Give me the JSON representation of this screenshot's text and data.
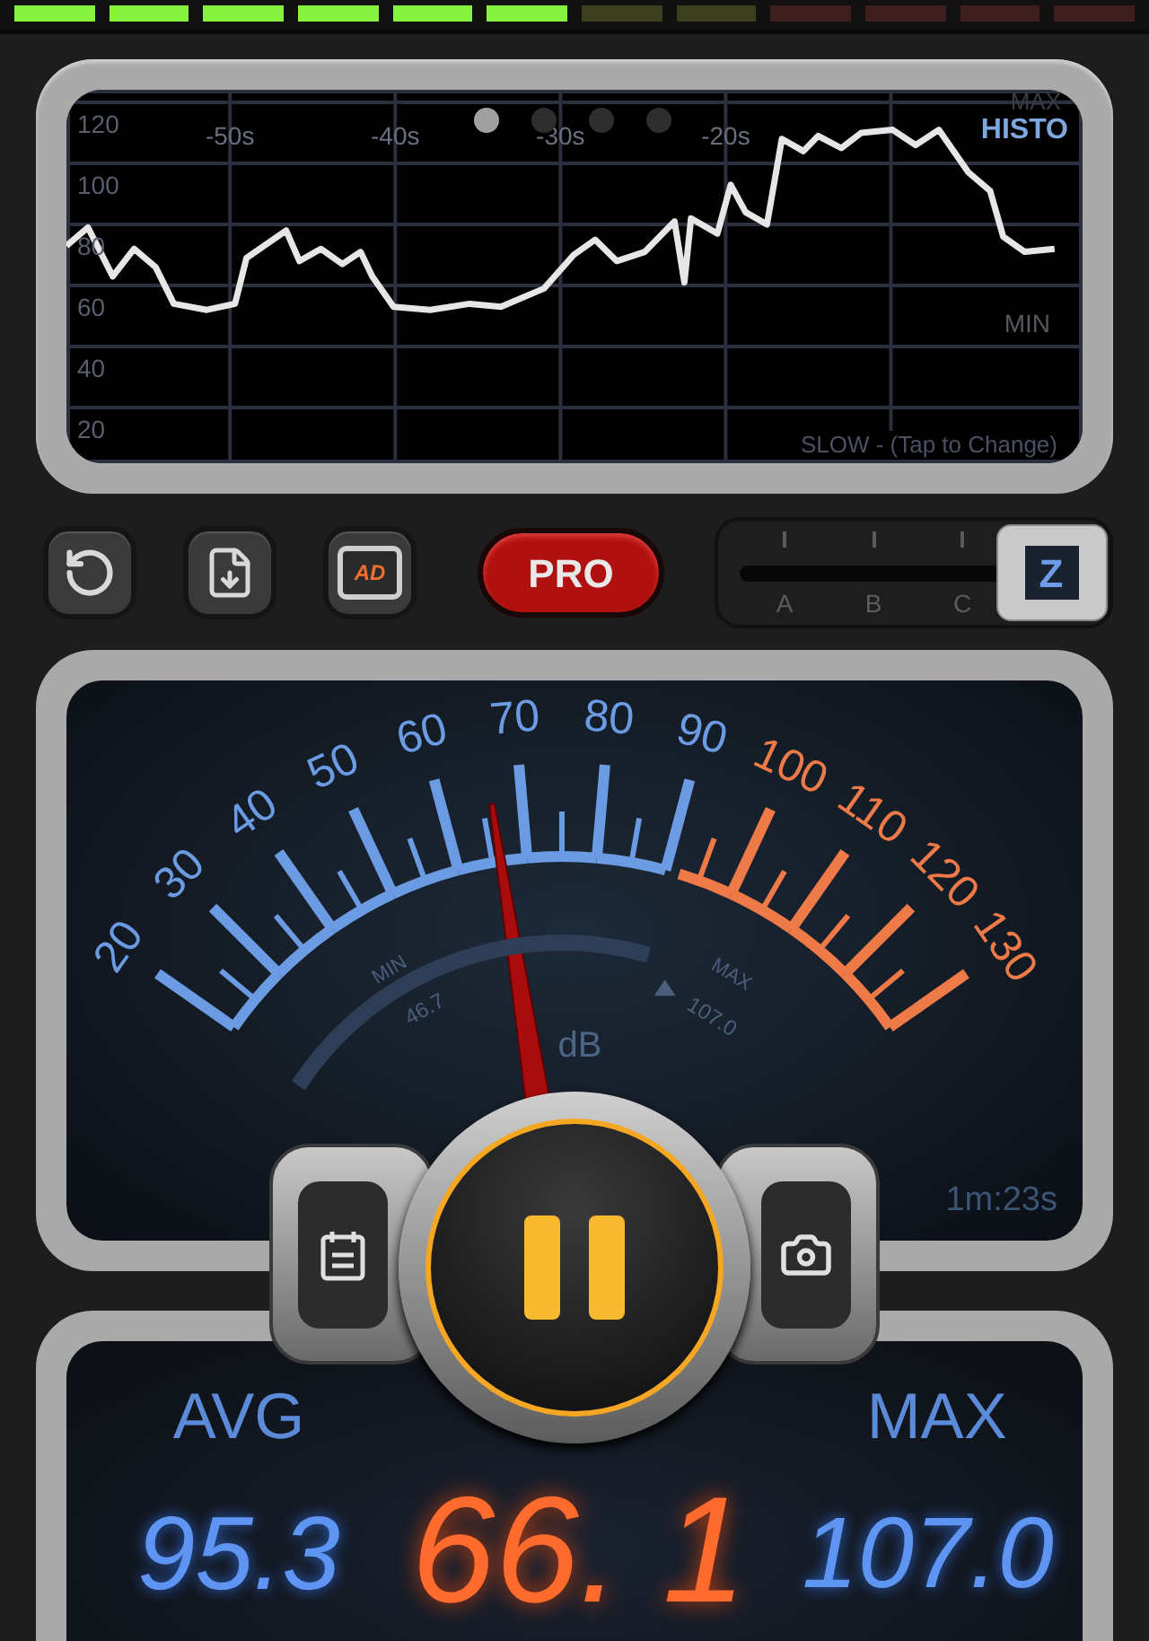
{
  "level_meter": {
    "level": 0.5
  },
  "history": {
    "pages": [
      {
        "selected": true
      },
      {
        "selected": false
      },
      {
        "selected": false
      },
      {
        "selected": false
      }
    ],
    "max_label": "MAX",
    "mode": "HISTO",
    "min_label": "MIN",
    "speed": "SLOW - (Tap to Change)",
    "chart_data": {
      "type": "line",
      "x": [
        -59.9,
        -58.6,
        -57.1,
        -55.8,
        -54.5,
        -53.4,
        -51.4,
        -49.7,
        -49.0,
        -46.6,
        -45.8,
        -44.5,
        -43.2,
        -42.1,
        -41.4,
        -40.1,
        -37.9,
        -35.5,
        -33.6,
        -31.0,
        -29.2,
        -27.9,
        -26.6,
        -24.9,
        -23.1,
        -22.5,
        -22.1,
        -20.5,
        -19.7,
        -18.8,
        -17.5,
        -16.6,
        -15.3,
        -14.4,
        -13.0,
        -11.8,
        -9.9,
        -8.5,
        -7.1,
        -5.3,
        -4.0,
        -3.2,
        -1.9,
        -0.1
      ],
      "series": [
        {
          "color": "#e6e6e6",
          "values": [
            73,
            79,
            63,
            72,
            66,
            54,
            52,
            54,
            69,
            78,
            68,
            72,
            67,
            71,
            63,
            53,
            52,
            54,
            53,
            59,
            70,
            75,
            68,
            71,
            81,
            61,
            82,
            77,
            93,
            84,
            80,
            108,
            104,
            109,
            105,
            110,
            111,
            106,
            111,
            97,
            91,
            76,
            71,
            72
          ]
        }
      ],
      "xlim": [
        -59.9,
        1.6
      ],
      "ylim": [
        1.8,
        124.1
      ],
      "grid": true,
      "xticks": [
        {
          "value": -50,
          "label": "-50s"
        },
        {
          "value": -40,
          "label": "-40s"
        },
        {
          "value": -30,
          "label": "-30s"
        },
        {
          "value": -20,
          "label": "-20s"
        }
      ],
      "yticks": [
        20,
        40,
        60,
        80,
        100,
        120
      ]
    }
  },
  "toolbar": {
    "buttons": [
      {
        "kind": "reset"
      },
      {
        "kind": "save"
      },
      {
        "kind": "ad",
        "label": "AD"
      }
    ],
    "pro": "PRO"
  },
  "weighting": {
    "options": [
      {
        "label": "A",
        "selected": false
      },
      {
        "label": "B",
        "selected": false
      },
      {
        "label": "C",
        "selected": false
      },
      {
        "label": "Z",
        "selected": true
      }
    ]
  },
  "gauge": {
    "scale": [
      {
        "label": "20",
        "color": "#6b9be2"
      },
      {
        "label": "30",
        "color": "#6b9be2"
      },
      {
        "label": "40",
        "color": "#6b9be2"
      },
      {
        "label": "50",
        "color": "#6b9be2"
      },
      {
        "label": "60",
        "color": "#6b9be2"
      },
      {
        "label": "70",
        "color": "#6b9be2"
      },
      {
        "label": "80",
        "color": "#6b9be2"
      },
      {
        "label": "90",
        "color": "#6b9be2"
      },
      {
        "label": "100",
        "color": "#ee7a48"
      },
      {
        "label": "110",
        "color": "#ee7a48"
      },
      {
        "label": "120",
        "color": "#ee7a48"
      },
      {
        "label": "130",
        "color": "#ee7a48"
      }
    ],
    "needle": {
      "level": 0.42
    },
    "min_label": "MIN",
    "min_value": "46.7",
    "max_label": "MAX",
    "max_value": "107.0",
    "unit": "dB",
    "elapsed": "1m:23s"
  },
  "readings": {
    "avg_label": "AVG",
    "avg": "95.3",
    "current": "66. 1",
    "max_label": "MAX",
    "max": "107.0"
  }
}
